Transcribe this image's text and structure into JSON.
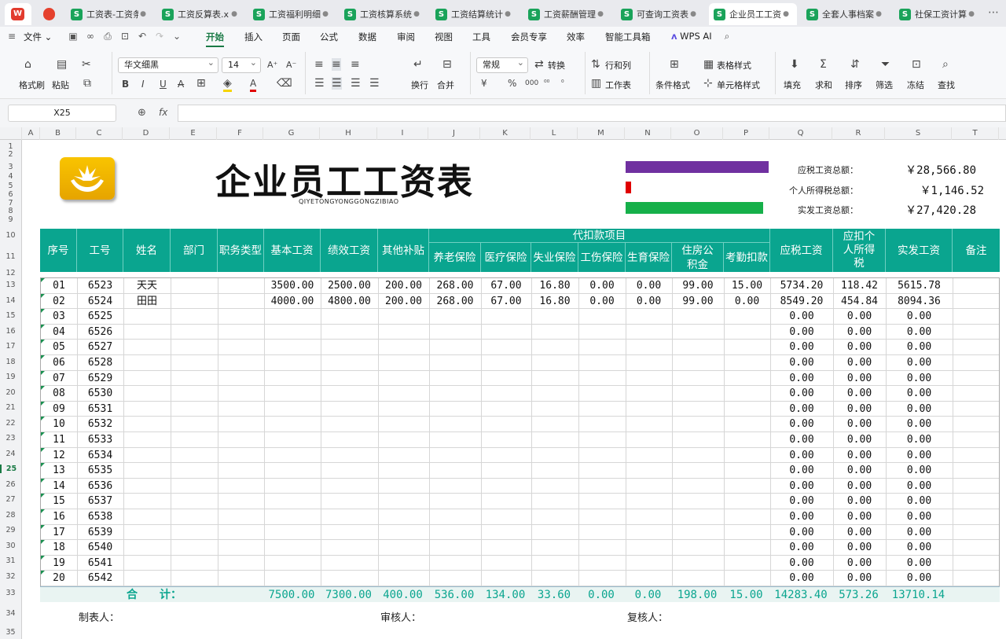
{
  "tabs": [
    {
      "label": "工资表-工资条"
    },
    {
      "label": "工资反算表.xlsx"
    },
    {
      "label": "工资福利明细表"
    },
    {
      "label": "工资核算系统"
    },
    {
      "label": "工资结算统计表"
    },
    {
      "label": "工资薪酬管理"
    },
    {
      "label": "可查询工资表"
    },
    {
      "label": "企业员工工资表"
    },
    {
      "label": "全套人事档案"
    },
    {
      "label": "社保工资计算"
    }
  ],
  "menu": {
    "file": "文件",
    "items": [
      "开始",
      "插入",
      "页面",
      "公式",
      "数据",
      "审阅",
      "视图",
      "工具",
      "会员专享",
      "效率",
      "智能工具箱"
    ],
    "wps_ai": "WPS AI"
  },
  "ribbon": {
    "format_painter": "格式刷",
    "paste": "粘贴",
    "font_name": "华文细黑",
    "font_size": "14",
    "wrap": "换行",
    "merge": "合并",
    "number_format": "常规",
    "convert": "转换",
    "rowcol": "行和列",
    "worksheet": "工作表",
    "cond_format": "条件格式",
    "table_style": "表格样式",
    "cell_style": "单元格样式",
    "fill": "填充",
    "sum": "求和",
    "sort": "排序",
    "filter": "筛选",
    "freeze": "冻结",
    "find": "查找",
    "bold": "B",
    "italic": "I",
    "underline": "U",
    "strike": "A",
    "percent": "%",
    "thousands": "000",
    "currency": "¥"
  },
  "formula_bar": {
    "cell_ref": "X25",
    "fx": "fx"
  },
  "columns": [
    "A",
    "B",
    "C",
    "D",
    "E",
    "F",
    "G",
    "H",
    "I",
    "J",
    "K",
    "L",
    "M",
    "N",
    "O",
    "P",
    "Q",
    "R",
    "S",
    "T"
  ],
  "rows": [
    "1",
    "2",
    "3",
    "4",
    "5",
    "6",
    "7",
    "8",
    "9",
    "10",
    "11",
    "12",
    "13",
    "14",
    "15",
    "16",
    "17",
    "18",
    "19",
    "20",
    "21",
    "22",
    "23",
    "24",
    "25",
    "26",
    "27",
    "28",
    "29",
    "30",
    "31",
    "32",
    "33",
    "34",
    "35"
  ],
  "sheet": {
    "title": "企业员工工资表",
    "subtitle": "QIYETONGYONGGONGZIBIAO",
    "colors": {
      "purple": "#7030a0",
      "red": "#e00000",
      "green": "#16b04a",
      "teal": "#0aa58f"
    },
    "progress": {
      "purple": 1.0,
      "red": 0.04,
      "green": 0.96
    },
    "summary": [
      {
        "label": "应税工资总额：",
        "value": "￥28,566.80"
      },
      {
        "label": "个人所得税总额：",
        "value": "￥1,146.52"
      },
      {
        "label": "实发工资总额：",
        "value": "￥27,420.28"
      }
    ],
    "headers": {
      "seq": "序号",
      "emp_no": "工号",
      "name": "姓名",
      "dept": "部门",
      "job_type": "职务类型",
      "base": "基本工资",
      "perf": "绩效工资",
      "other": "其他补贴",
      "group": "代扣款项目",
      "pension": "养老保险",
      "medical": "医疗保险",
      "unemploy": "失业保险",
      "injury": "工伤保险",
      "maternity": "生育保险",
      "housing_1": "住房公",
      "housing_2": "积金",
      "attendance": "考勤扣款",
      "taxable": "应税工资",
      "tax_1": "应扣个",
      "tax_2": "人所得",
      "tax_3": "税",
      "net": "实发工资",
      "remark": "备注"
    },
    "records": [
      [
        "01",
        "6523",
        "天天",
        "",
        "",
        "3500.00",
        "2500.00",
        "200.00",
        "268.00",
        "67.00",
        "16.80",
        "0.00",
        "0.00",
        "99.00",
        "15.00",
        "5734.20",
        "118.42",
        "5615.78"
      ],
      [
        "02",
        "6524",
        "田田",
        "",
        "",
        "4000.00",
        "4800.00",
        "200.00",
        "268.00",
        "67.00",
        "16.80",
        "0.00",
        "0.00",
        "99.00",
        "0.00",
        "8549.20",
        "454.84",
        "8094.36"
      ],
      [
        "03",
        "6525",
        "",
        "",
        "",
        "",
        "",
        "",
        "",
        "",
        "",
        "",
        "",
        "",
        "",
        "0.00",
        "0.00",
        "0.00"
      ],
      [
        "04",
        "6526",
        "",
        "",
        "",
        "",
        "",
        "",
        "",
        "",
        "",
        "",
        "",
        "",
        "",
        "0.00",
        "0.00",
        "0.00"
      ],
      [
        "05",
        "6527",
        "",
        "",
        "",
        "",
        "",
        "",
        "",
        "",
        "",
        "",
        "",
        "",
        "",
        "0.00",
        "0.00",
        "0.00"
      ],
      [
        "06",
        "6528",
        "",
        "",
        "",
        "",
        "",
        "",
        "",
        "",
        "",
        "",
        "",
        "",
        "",
        "0.00",
        "0.00",
        "0.00"
      ],
      [
        "07",
        "6529",
        "",
        "",
        "",
        "",
        "",
        "",
        "",
        "",
        "",
        "",
        "",
        "",
        "",
        "0.00",
        "0.00",
        "0.00"
      ],
      [
        "08",
        "6530",
        "",
        "",
        "",
        "",
        "",
        "",
        "",
        "",
        "",
        "",
        "",
        "",
        "",
        "0.00",
        "0.00",
        "0.00"
      ],
      [
        "09",
        "6531",
        "",
        "",
        "",
        "",
        "",
        "",
        "",
        "",
        "",
        "",
        "",
        "",
        "",
        "0.00",
        "0.00",
        "0.00"
      ],
      [
        "10",
        "6532",
        "",
        "",
        "",
        "",
        "",
        "",
        "",
        "",
        "",
        "",
        "",
        "",
        "",
        "0.00",
        "0.00",
        "0.00"
      ],
      [
        "11",
        "6533",
        "",
        "",
        "",
        "",
        "",
        "",
        "",
        "",
        "",
        "",
        "",
        "",
        "",
        "0.00",
        "0.00",
        "0.00"
      ],
      [
        "12",
        "6534",
        "",
        "",
        "",
        "",
        "",
        "",
        "",
        "",
        "",
        "",
        "",
        "",
        "",
        "0.00",
        "0.00",
        "0.00"
      ],
      [
        "13",
        "6535",
        "",
        "",
        "",
        "",
        "",
        "",
        "",
        "",
        "",
        "",
        "",
        "",
        "",
        "0.00",
        "0.00",
        "0.00"
      ],
      [
        "14",
        "6536",
        "",
        "",
        "",
        "",
        "",
        "",
        "",
        "",
        "",
        "",
        "",
        "",
        "",
        "0.00",
        "0.00",
        "0.00"
      ],
      [
        "15",
        "6537",
        "",
        "",
        "",
        "",
        "",
        "",
        "",
        "",
        "",
        "",
        "",
        "",
        "",
        "0.00",
        "0.00",
        "0.00"
      ],
      [
        "16",
        "6538",
        "",
        "",
        "",
        "",
        "",
        "",
        "",
        "",
        "",
        "",
        "",
        "",
        "",
        "0.00",
        "0.00",
        "0.00"
      ],
      [
        "17",
        "6539",
        "",
        "",
        "",
        "",
        "",
        "",
        "",
        "",
        "",
        "",
        "",
        "",
        "",
        "0.00",
        "0.00",
        "0.00"
      ],
      [
        "18",
        "6540",
        "",
        "",
        "",
        "",
        "",
        "",
        "",
        "",
        "",
        "",
        "",
        "",
        "",
        "0.00",
        "0.00",
        "0.00"
      ],
      [
        "19",
        "6541",
        "",
        "",
        "",
        "",
        "",
        "",
        "",
        "",
        "",
        "",
        "",
        "",
        "",
        "0.00",
        "0.00",
        "0.00"
      ],
      [
        "20",
        "6542",
        "",
        "",
        "",
        "",
        "",
        "",
        "",
        "",
        "",
        "",
        "",
        "",
        "",
        "0.00",
        "0.00",
        "0.00"
      ]
    ],
    "totals": {
      "label": "合　　计：",
      "values": [
        "7500.00",
        "7300.00",
        "400.00",
        "536.00",
        "134.00",
        "33.60",
        "0.00",
        "0.00",
        "198.00",
        "15.00",
        "14283.40",
        "573.26",
        "13710.14"
      ]
    },
    "footer": {
      "maker": "制表人：",
      "reviewer": "审核人：",
      "rechecker": "复核人："
    }
  }
}
